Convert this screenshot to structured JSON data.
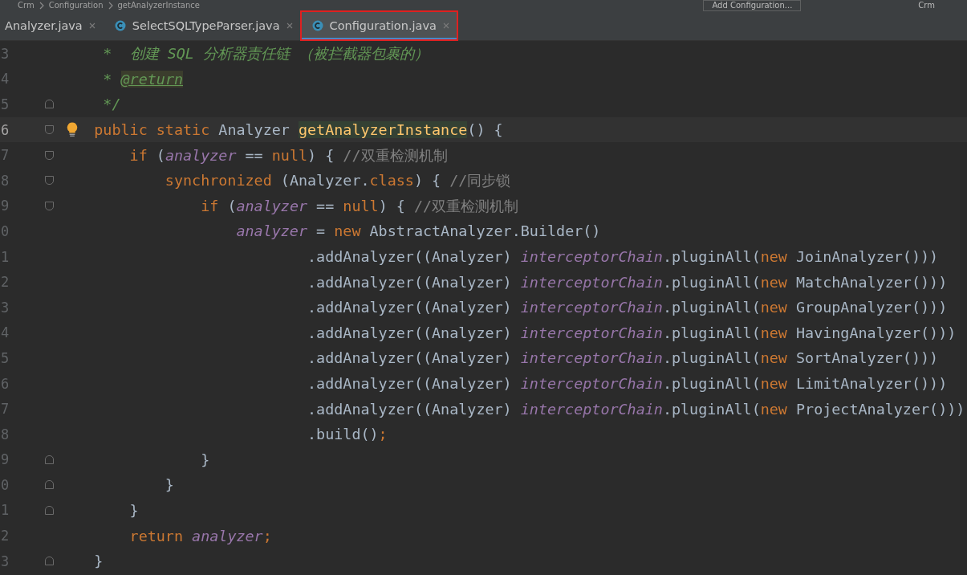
{
  "breadcrumb": {
    "items": [
      "Crm",
      "Configuration",
      "getAnalyzerInstance"
    ],
    "run_config": "Add Configuration...",
    "user": "Crm"
  },
  "tabs": [
    {
      "label": "Analyzer.java",
      "icon": false,
      "selected": false,
      "annotated": false
    },
    {
      "label": "SelectSQLTypeParser.java",
      "icon": true,
      "selected": false,
      "annotated": false
    },
    {
      "label": "Configuration.java",
      "icon": true,
      "selected": true,
      "annotated": true
    }
  ],
  "lines": [
    {
      "number": "3",
      "current": false,
      "fold_start": false,
      "fold_end": false,
      "tokens": [
        {
          "kind": "doc",
          "text": "     *  创建 SQL 分析器责任链 （被拦截器包裹的）"
        }
      ]
    },
    {
      "number": "4",
      "current": false,
      "fold_start": false,
      "fold_end": false,
      "tokens": [
        {
          "kind": "doc",
          "text": "     * "
        },
        {
          "kind": "doctag",
          "text": "@return"
        }
      ]
    },
    {
      "number": "5",
      "current": false,
      "fold_start": false,
      "fold_end": true,
      "tokens": [
        {
          "kind": "doc",
          "text": "     */"
        }
      ]
    },
    {
      "number": "6",
      "current": true,
      "fold_start": true,
      "fold_end": false,
      "bulb": true,
      "tokens": [
        {
          "kind": "keyword",
          "text": "    public static"
        },
        {
          "kind": "plain",
          "text": " Analyzer "
        },
        {
          "kind": "method",
          "text": "getAnalyzerInstance"
        },
        {
          "kind": "plain",
          "text": "() {"
        }
      ]
    },
    {
      "number": "7",
      "current": false,
      "fold_start": true,
      "fold_end": false,
      "tokens": [
        {
          "kind": "keyword",
          "text": "        if"
        },
        {
          "kind": "plain",
          "text": " ("
        },
        {
          "kind": "field",
          "text": "analyzer"
        },
        {
          "kind": "plain",
          "text": " == "
        },
        {
          "kind": "keyword",
          "text": "null"
        },
        {
          "kind": "plain",
          "text": ") { "
        },
        {
          "kind": "comment",
          "text": "//双重检测机制"
        }
      ]
    },
    {
      "number": "8",
      "current": false,
      "fold_start": true,
      "fold_end": false,
      "tokens": [
        {
          "kind": "keyword",
          "text": "            synchronized"
        },
        {
          "kind": "plain",
          "text": " (Analyzer."
        },
        {
          "kind": "keyword",
          "text": "class"
        },
        {
          "kind": "plain",
          "text": ") { "
        },
        {
          "kind": "comment",
          "text": "//同步锁"
        }
      ]
    },
    {
      "number": "9",
      "current": false,
      "fold_start": true,
      "fold_end": false,
      "tokens": [
        {
          "kind": "keyword",
          "text": "                if"
        },
        {
          "kind": "plain",
          "text": " ("
        },
        {
          "kind": "field",
          "text": "analyzer"
        },
        {
          "kind": "plain",
          "text": " == "
        },
        {
          "kind": "keyword",
          "text": "null"
        },
        {
          "kind": "plain",
          "text": ") { "
        },
        {
          "kind": "comment",
          "text": "//双重检测机制"
        }
      ]
    },
    {
      "number": "0",
      "current": false,
      "fold_start": false,
      "fold_end": false,
      "tokens": [
        {
          "kind": "field",
          "text": "                    analyzer"
        },
        {
          "kind": "plain",
          "text": " = "
        },
        {
          "kind": "keyword",
          "text": "new"
        },
        {
          "kind": "plain",
          "text": " AbstractAnalyzer.Builder()"
        }
      ]
    },
    {
      "number": "1",
      "current": false,
      "fold_start": false,
      "fold_end": false,
      "tokens": [
        {
          "kind": "plain",
          "text": "                            .addAnalyzer((Analyzer) "
        },
        {
          "kind": "field",
          "text": "interceptorChain"
        },
        {
          "kind": "plain",
          "text": ".pluginAll("
        },
        {
          "kind": "keyword",
          "text": "new"
        },
        {
          "kind": "plain",
          "text": " JoinAnalyzer()))"
        }
      ]
    },
    {
      "number": "2",
      "current": false,
      "fold_start": false,
      "fold_end": false,
      "tokens": [
        {
          "kind": "plain",
          "text": "                            .addAnalyzer((Analyzer) "
        },
        {
          "kind": "field",
          "text": "interceptorChain"
        },
        {
          "kind": "plain",
          "text": ".pluginAll("
        },
        {
          "kind": "keyword",
          "text": "new"
        },
        {
          "kind": "plain",
          "text": " MatchAnalyzer()))"
        }
      ]
    },
    {
      "number": "3",
      "current": false,
      "fold_start": false,
      "fold_end": false,
      "tokens": [
        {
          "kind": "plain",
          "text": "                            .addAnalyzer((Analyzer) "
        },
        {
          "kind": "field",
          "text": "interceptorChain"
        },
        {
          "kind": "plain",
          "text": ".pluginAll("
        },
        {
          "kind": "keyword",
          "text": "new"
        },
        {
          "kind": "plain",
          "text": " GroupAnalyzer()))"
        }
      ]
    },
    {
      "number": "4",
      "current": false,
      "fold_start": false,
      "fold_end": false,
      "tokens": [
        {
          "kind": "plain",
          "text": "                            .addAnalyzer((Analyzer) "
        },
        {
          "kind": "field",
          "text": "interceptorChain"
        },
        {
          "kind": "plain",
          "text": ".pluginAll("
        },
        {
          "kind": "keyword",
          "text": "new"
        },
        {
          "kind": "plain",
          "text": " HavingAnalyzer()))"
        }
      ]
    },
    {
      "number": "5",
      "current": false,
      "fold_start": false,
      "fold_end": false,
      "tokens": [
        {
          "kind": "plain",
          "text": "                            .addAnalyzer((Analyzer) "
        },
        {
          "kind": "field",
          "text": "interceptorChain"
        },
        {
          "kind": "plain",
          "text": ".pluginAll("
        },
        {
          "kind": "keyword",
          "text": "new"
        },
        {
          "kind": "plain",
          "text": " SortAnalyzer()))"
        }
      ]
    },
    {
      "number": "6",
      "current": false,
      "fold_start": false,
      "fold_end": false,
      "tokens": [
        {
          "kind": "plain",
          "text": "                            .addAnalyzer((Analyzer) "
        },
        {
          "kind": "field",
          "text": "interceptorChain"
        },
        {
          "kind": "plain",
          "text": ".pluginAll("
        },
        {
          "kind": "keyword",
          "text": "new"
        },
        {
          "kind": "plain",
          "text": " LimitAnalyzer()))"
        }
      ]
    },
    {
      "number": "7",
      "current": false,
      "fold_start": false,
      "fold_end": false,
      "tokens": [
        {
          "kind": "plain",
          "text": "                            .addAnalyzer((Analyzer) "
        },
        {
          "kind": "field",
          "text": "interceptorChain"
        },
        {
          "kind": "plain",
          "text": ".pluginAll("
        },
        {
          "kind": "keyword",
          "text": "new"
        },
        {
          "kind": "plain",
          "text": " ProjectAnalyzer()))"
        }
      ]
    },
    {
      "number": "8",
      "current": false,
      "fold_start": false,
      "fold_end": false,
      "tokens": [
        {
          "kind": "plain",
          "text": "                            .build()"
        },
        {
          "kind": "keyword",
          "text": ";"
        }
      ]
    },
    {
      "number": "9",
      "current": false,
      "fold_start": false,
      "fold_end": true,
      "tokens": [
        {
          "kind": "plain",
          "text": "                }"
        }
      ]
    },
    {
      "number": "0",
      "current": false,
      "fold_start": false,
      "fold_end": true,
      "tokens": [
        {
          "kind": "plain",
          "text": "            }"
        }
      ]
    },
    {
      "number": "1",
      "current": false,
      "fold_start": false,
      "fold_end": true,
      "tokens": [
        {
          "kind": "plain",
          "text": "        }"
        }
      ]
    },
    {
      "number": "2",
      "current": false,
      "fold_start": false,
      "fold_end": false,
      "tokens": [
        {
          "kind": "keyword",
          "text": "        return"
        },
        {
          "kind": "field",
          "text": " analyzer"
        },
        {
          "kind": "keyword",
          "text": ";"
        }
      ]
    },
    {
      "number": "3",
      "current": false,
      "fold_start": false,
      "fold_end": true,
      "tokens": [
        {
          "kind": "plain",
          "text": "    }"
        }
      ]
    }
  ]
}
